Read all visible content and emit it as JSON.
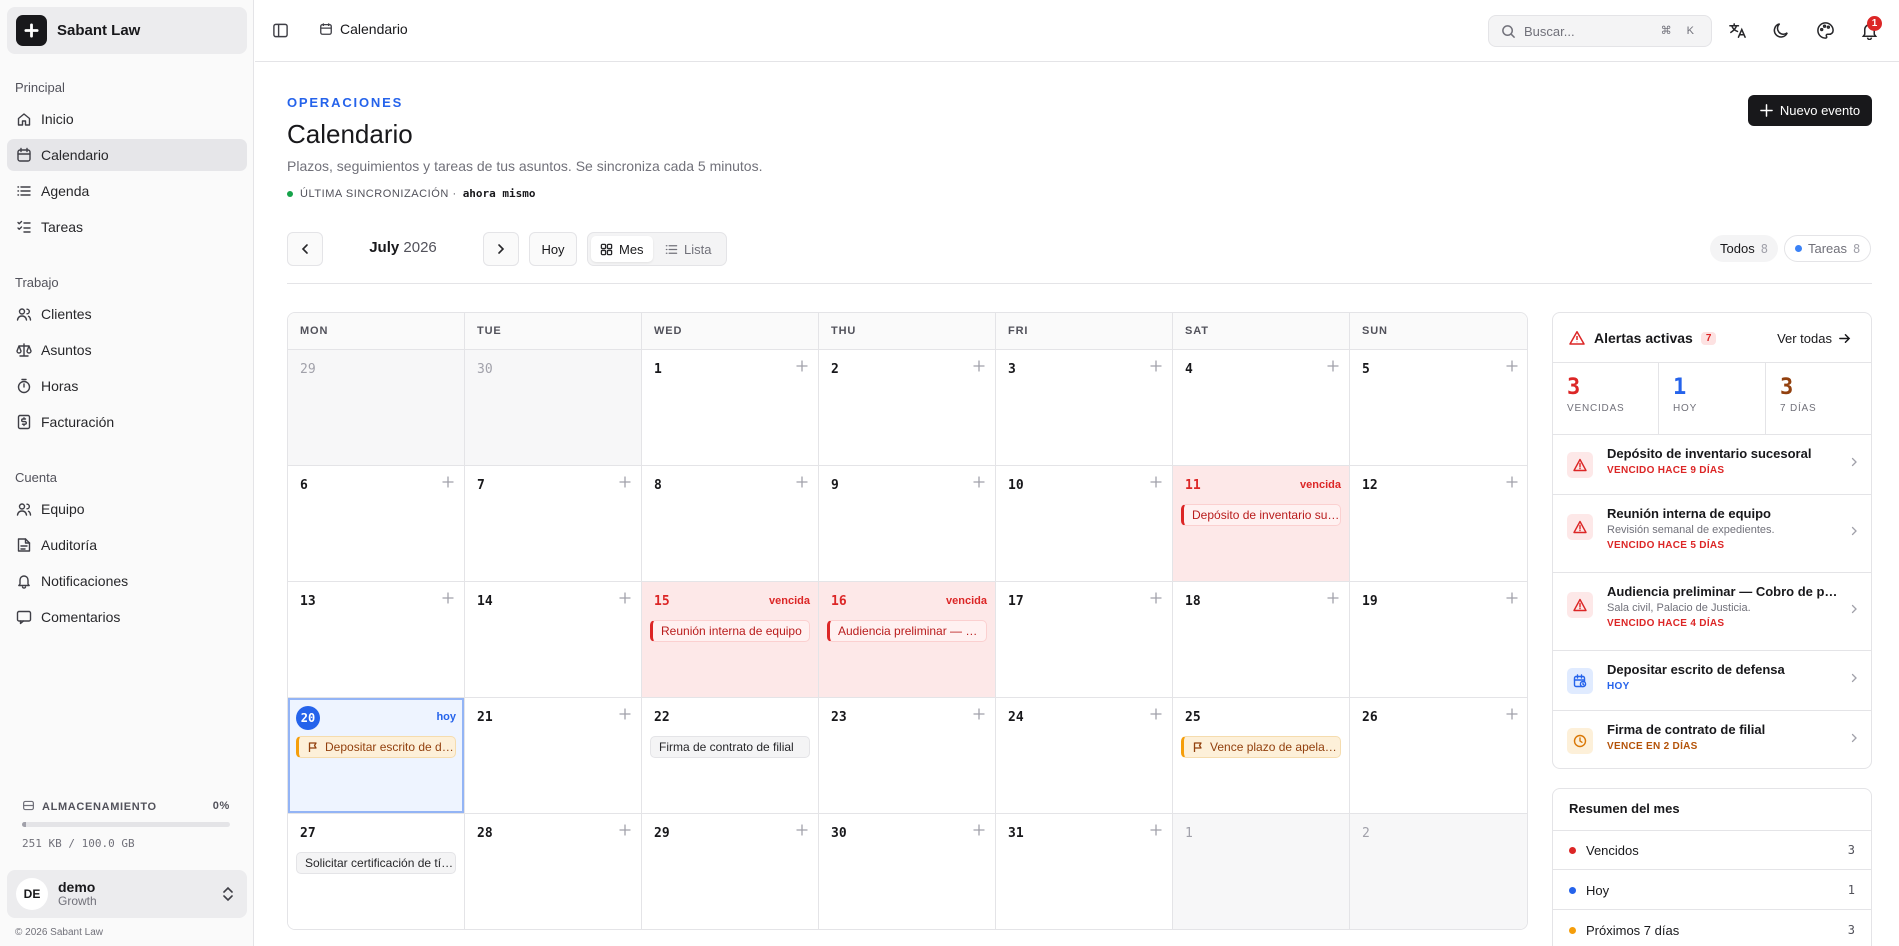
{
  "brand": {
    "name": "Sabant Law"
  },
  "nav": {
    "groups": [
      {
        "label": "Principal",
        "items": [
          {
            "label": "Inicio",
            "icon": "home-icon"
          },
          {
            "label": "Calendario",
            "icon": "calendar-icon",
            "active": true
          },
          {
            "label": "Agenda",
            "icon": "list-icon"
          },
          {
            "label": "Tareas",
            "icon": "tasks-icon"
          }
        ]
      },
      {
        "label": "Trabajo",
        "items": [
          {
            "label": "Clientes",
            "icon": "users-icon"
          },
          {
            "label": "Asuntos",
            "icon": "scale-icon"
          },
          {
            "label": "Horas",
            "icon": "timer-icon"
          },
          {
            "label": "Facturación",
            "icon": "invoice-icon"
          }
        ]
      },
      {
        "label": "Cuenta",
        "items": [
          {
            "label": "Equipo",
            "icon": "team-icon"
          },
          {
            "label": "Auditoría",
            "icon": "audit-icon"
          },
          {
            "label": "Notificaciones",
            "icon": "bell-icon"
          },
          {
            "label": "Comentarios",
            "icon": "comment-icon"
          }
        ]
      }
    ]
  },
  "storage": {
    "label": "ALMACENAMIENTO",
    "percent_label": "0%",
    "percent": 0.02,
    "usage": "251 KB / 100.0 GB"
  },
  "user": {
    "initials": "DE",
    "name": "demo",
    "plan": "Growth"
  },
  "footer": {
    "copyright": "© 2026 Sabant Law"
  },
  "topbar": {
    "breadcrumb": "Calendario",
    "search_placeholder": "Buscar...",
    "search_shortcut": "⌘ K",
    "notification_count": "1"
  },
  "header": {
    "eyebrow": "OPERACIONES",
    "title": "Calendario",
    "description": "Plazos, seguimientos y tareas de tus asuntos. Se sincroniza cada 5 minutos.",
    "sync_label": "ÚLTIMA SINCRONIZACIÓN ·",
    "sync_value": "ahora mismo",
    "new_event": "Nuevo evento"
  },
  "toolbar": {
    "month": "July",
    "year": "2026",
    "today": "Hoy",
    "views": [
      "Mes",
      "Lista"
    ],
    "filters": [
      {
        "label": "Todos",
        "count": "8"
      },
      {
        "label": "Tareas",
        "count": "8"
      }
    ]
  },
  "calendar": {
    "weekdays": [
      "MON",
      "TUE",
      "WED",
      "THU",
      "FRI",
      "SAT",
      "SUN"
    ],
    "overdue_tag": "vencida",
    "today_tag": "hoy",
    "days": [
      {
        "n": "29",
        "other": true
      },
      {
        "n": "30",
        "other": true
      },
      {
        "n": "1"
      },
      {
        "n": "2"
      },
      {
        "n": "3"
      },
      {
        "n": "4"
      },
      {
        "n": "5"
      },
      {
        "n": "6"
      },
      {
        "n": "7"
      },
      {
        "n": "8"
      },
      {
        "n": "9"
      },
      {
        "n": "10"
      },
      {
        "n": "11",
        "overdue": true,
        "event": {
          "text": "Depósito de inventario sucesoral",
          "style": "red"
        }
      },
      {
        "n": "12"
      },
      {
        "n": "13"
      },
      {
        "n": "14"
      },
      {
        "n": "15",
        "overdue": true,
        "event": {
          "text": "Reunión interna de equipo",
          "style": "red"
        }
      },
      {
        "n": "16",
        "overdue": true,
        "event": {
          "text": "Audiencia preliminar — Cobro de pesos",
          "style": "red"
        }
      },
      {
        "n": "17"
      },
      {
        "n": "18"
      },
      {
        "n": "19"
      },
      {
        "n": "20",
        "today": true,
        "event": {
          "text": "Depositar escrito de defensa",
          "style": "amber",
          "flag": true
        }
      },
      {
        "n": "21"
      },
      {
        "n": "22",
        "event": {
          "text": "Firma de contrato de filial",
          "style": "gray"
        }
      },
      {
        "n": "23"
      },
      {
        "n": "24"
      },
      {
        "n": "25",
        "event": {
          "text": "Vence plazo de apelación",
          "style": "amber",
          "flag": true
        }
      },
      {
        "n": "26"
      },
      {
        "n": "27",
        "event": {
          "text": "Solicitar certificación de título",
          "style": "gray"
        }
      },
      {
        "n": "28"
      },
      {
        "n": "29"
      },
      {
        "n": "30"
      },
      {
        "n": "31"
      },
      {
        "n": "1",
        "other": true
      },
      {
        "n": "2",
        "other": true
      }
    ]
  },
  "alerts": {
    "title": "Alertas activas",
    "count": "7",
    "view_all": "Ver todas",
    "stats": [
      {
        "value": "3",
        "label": "VENCIDAS",
        "color": "#dc2626"
      },
      {
        "value": "1",
        "label": "HOY",
        "color": "#2563eb"
      },
      {
        "value": "3",
        "label": "7 DÍAS",
        "color": "#92400e"
      }
    ],
    "items": [
      {
        "name": "Depósito de inventario sucesoral",
        "sub": "",
        "due": "VENCIDO HACE 9 DÍAS",
        "kind": "overdue"
      },
      {
        "name": "Reunión interna de equipo",
        "sub": "Revisión semanal de expedientes.",
        "due": "VENCIDO HACE 5 DÍAS",
        "kind": "overdue"
      },
      {
        "name": "Audiencia preliminar — Cobro de pesos",
        "sub": "Sala civil, Palacio de Justicia.",
        "due": "VENCIDO HACE 4 DÍAS",
        "kind": "overdue"
      },
      {
        "name": "Depositar escrito de defensa",
        "sub": "",
        "due": "HOY",
        "kind": "today"
      },
      {
        "name": "Firma de contrato de filial",
        "sub": "",
        "due": "VENCE EN 2 DÍAS",
        "kind": "soon"
      }
    ]
  },
  "summary": {
    "title": "Resumen del mes",
    "rows": [
      {
        "label": "Vencidos",
        "value": "3",
        "color": "#dc2626"
      },
      {
        "label": "Hoy",
        "value": "1",
        "color": "#2563eb"
      },
      {
        "label": "Próximos 7 días",
        "value": "3",
        "color": "#f59e0b"
      }
    ]
  },
  "colors": {
    "accent": "#2563eb",
    "danger": "#dc2626",
    "warning": "#f59e0b",
    "dark": "#18181b"
  }
}
